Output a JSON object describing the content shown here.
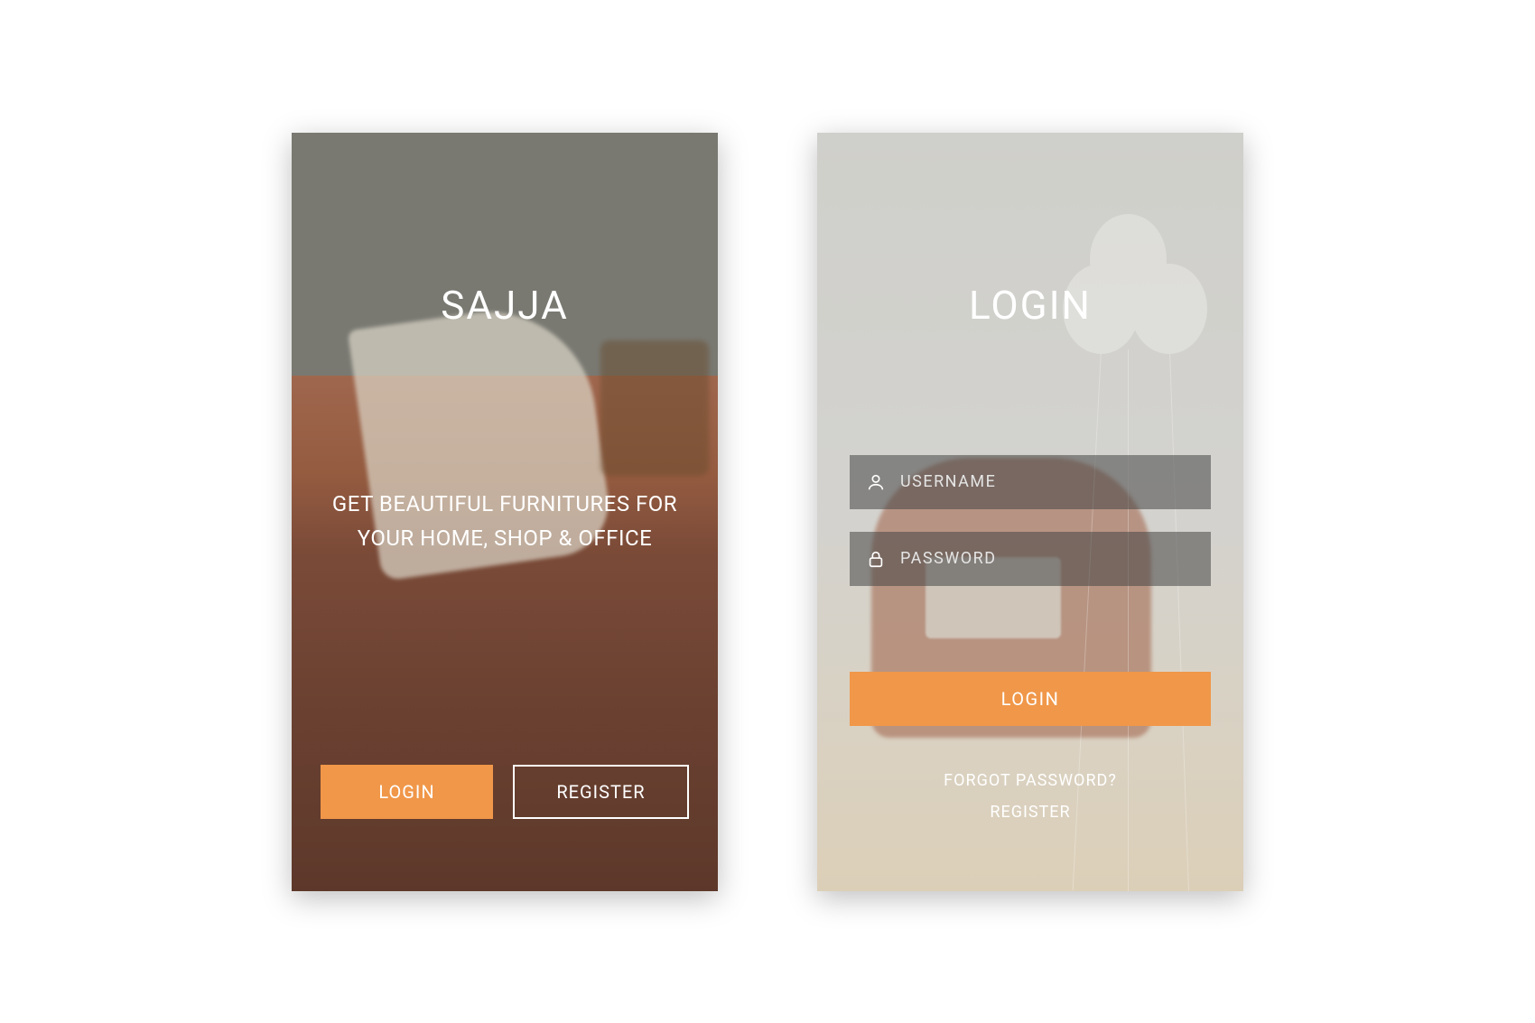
{
  "welcome": {
    "brand": "SAJJA",
    "tagline": "GET BEAUTIFUL FURNITURES FOR YOUR HOME, SHOP & OFFICE",
    "login_label": "LOGIN",
    "register_label": "REGISTER"
  },
  "login": {
    "title": "LOGIN",
    "username_placeholder": "USERNAME",
    "password_placeholder": "PASSWORD",
    "login_label": "LOGIN",
    "forgot_label": "FORGOT PASSWORD?",
    "register_label": "REGISTER"
  },
  "colors": {
    "accent": "#f09749"
  }
}
